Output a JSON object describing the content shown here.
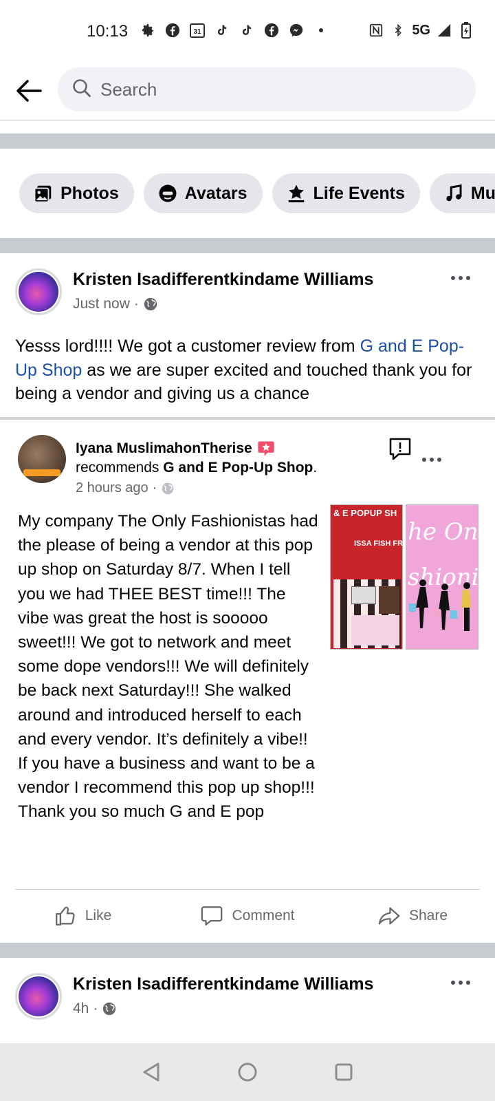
{
  "status_bar": {
    "time": "10:13",
    "calendar_day": "31",
    "network": "5G",
    "icons": [
      "settings-icon",
      "facebook-icon",
      "calendar-icon",
      "tiktok-icon",
      "tiktok-icon",
      "facebook-icon",
      "messenger-icon",
      "dot-icon",
      "nfc-icon",
      "bluetooth-icon",
      "signal-icon",
      "battery-charging-icon"
    ]
  },
  "header": {
    "search_placeholder": "Search"
  },
  "chips": [
    {
      "label": "Photos",
      "icon": "photos-icon"
    },
    {
      "label": "Avatars",
      "icon": "avatar-icon"
    },
    {
      "label": "Life Events",
      "icon": "star-flag-icon"
    },
    {
      "label": "Mu",
      "icon": "music-icon"
    }
  ],
  "post1": {
    "author": "Kristen Isadifferentkindame Williams",
    "time": "Just now",
    "separator": "·",
    "privacy_icon": "globe-icon",
    "text_before": "Yesss lord!!!! We got a customer review from ",
    "link": "G and E Pop-Up Shop",
    "text_after": "  as we are super excited and touched thank you for being a vendor and giving us a chance"
  },
  "shared": {
    "name": "Iyana MuslimahonTherise",
    "recommends_prefix": "recommends ",
    "page_name": "G and E Pop-Up Shop",
    "period": ".",
    "time": "2 hours ago",
    "separator": "·",
    "review": "My company The Only Fashionistas had the please of being a vendor at this pop up shop on Saturday 8/7. When I tell you we had THEE BEST time!!! The vibe was great the host is sooooo sweet!!! We got to network and meet some dope vendors!!! We will definitely be back next Saturday!!! She walked around and introduced herself to each and every vendor. It’s definitely a vibe!! If you have a business and want to be a vendor I recommend this pop up shop!!! Thank you so much G and E pop",
    "flyer_title": "& E  POPUP SH",
    "flyer_sub": "ISSA FISH FR",
    "pink_text": "he On\nshionis"
  },
  "actions": {
    "like": "Like",
    "comment": "Comment",
    "share": "Share"
  },
  "post2": {
    "author": "Kristen Isadifferentkindame Williams",
    "time": "4h",
    "separator": "·"
  }
}
